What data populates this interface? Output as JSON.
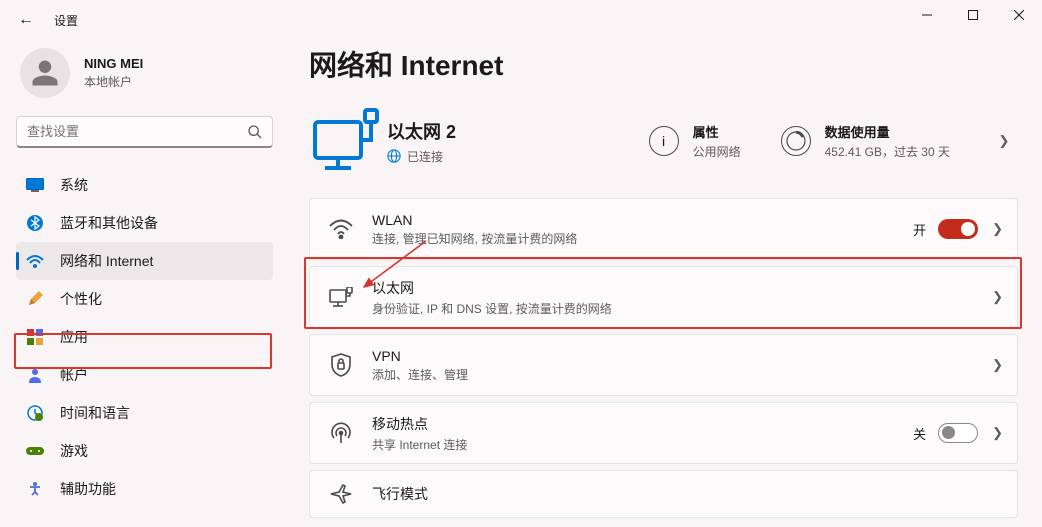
{
  "window": {
    "title": "设置"
  },
  "user": {
    "name": "NING MEI",
    "sub": "本地帐户"
  },
  "search": {
    "placeholder": "查找设置"
  },
  "nav": [
    {
      "key": "system",
      "label": "系统"
    },
    {
      "key": "bluetooth",
      "label": "蓝牙和其他设备"
    },
    {
      "key": "network",
      "label": "网络和 Internet",
      "active": true
    },
    {
      "key": "personalize",
      "label": "个性化"
    },
    {
      "key": "apps",
      "label": "应用"
    },
    {
      "key": "accounts",
      "label": "帐户"
    },
    {
      "key": "time",
      "label": "时间和语言"
    },
    {
      "key": "gaming",
      "label": "游戏"
    },
    {
      "key": "accessibility",
      "label": "辅助功能"
    }
  ],
  "page": {
    "title": "网络和 Internet"
  },
  "status": {
    "name": "以太网 2",
    "connected": "已连接",
    "properties": {
      "title": "属性",
      "sub": "公用网络"
    },
    "data": {
      "title": "数据使用量",
      "sub": "452.41 GB，过去 30 天"
    }
  },
  "cards": {
    "wlan": {
      "title": "WLAN",
      "sub": "连接, 管理已知网络, 按流量计费的网络",
      "state": "开"
    },
    "ethernet": {
      "title": "以太网",
      "sub": "身份验证, IP 和 DNS 设置, 按流量计费的网络"
    },
    "vpn": {
      "title": "VPN",
      "sub": "添加、连接、管理"
    },
    "hotspot": {
      "title": "移动热点",
      "sub": "共享 Internet 连接",
      "state": "关"
    },
    "airplane": {
      "title": "飞行模式"
    }
  }
}
